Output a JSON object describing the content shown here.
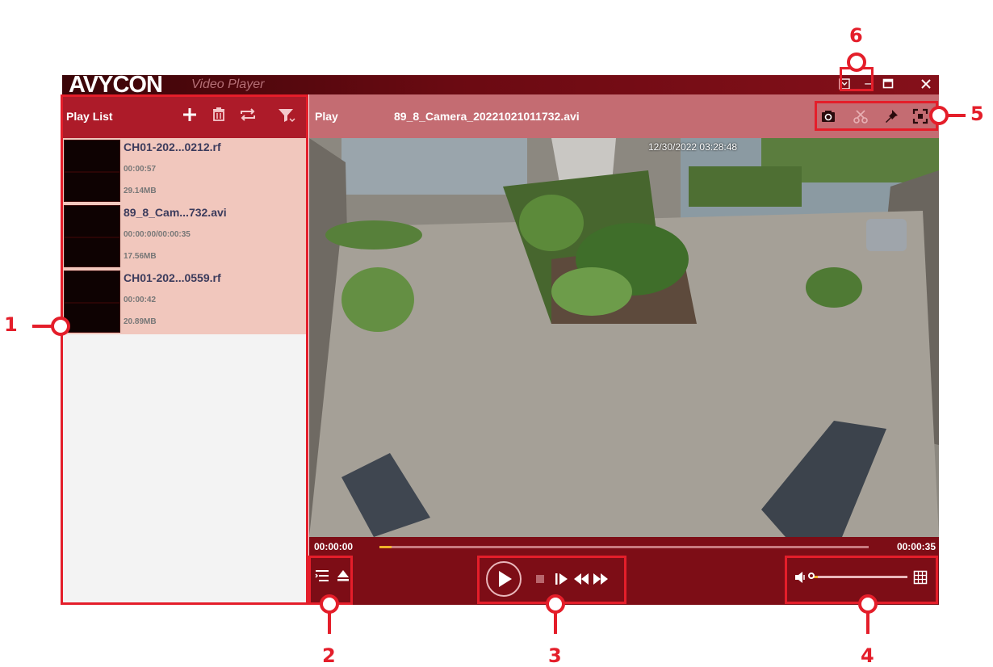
{
  "app": {
    "logo": "AVYCON",
    "logo_sub": "Video Player",
    "window_buttons": {
      "menu": "▾",
      "minimize": "–",
      "maximize": "□",
      "close": "✕"
    }
  },
  "playlist": {
    "title": "Play List",
    "tools": [
      "add-icon",
      "trash-icon",
      "repeat-icon",
      "filter-icon"
    ],
    "items": [
      {
        "name": "CH01-202...0212.rf",
        "duration": "00:00:57",
        "size": "29.14MB"
      },
      {
        "name": "89_8_Cam...732.avi",
        "duration": "00:00:00/00:00:35",
        "size": "17.56MB"
      },
      {
        "name": "CH01-202...0559.rf",
        "duration": "00:00:42",
        "size": "20.89MB"
      }
    ]
  },
  "player": {
    "label": "Play",
    "file": "89_8_Camera_20221021011732.avi",
    "tools": [
      "camera-icon",
      "scissors-icon",
      "pin-icon",
      "fullscreen-icon"
    ],
    "timestamp": "12/30/2022 03:28:48",
    "time_start": "00:00:00",
    "time_end": "00:00:35",
    "progress": 0.025,
    "volume": 0.08
  },
  "callouts": {
    "c1": "1",
    "c2": "2",
    "c3": "3",
    "c4": "4",
    "c5": "5",
    "c6": "6"
  },
  "colors": {
    "accent": "#e41e2a",
    "bar": "#7d0d16",
    "header": "#ad1b29",
    "progress": "#f0b22a"
  }
}
